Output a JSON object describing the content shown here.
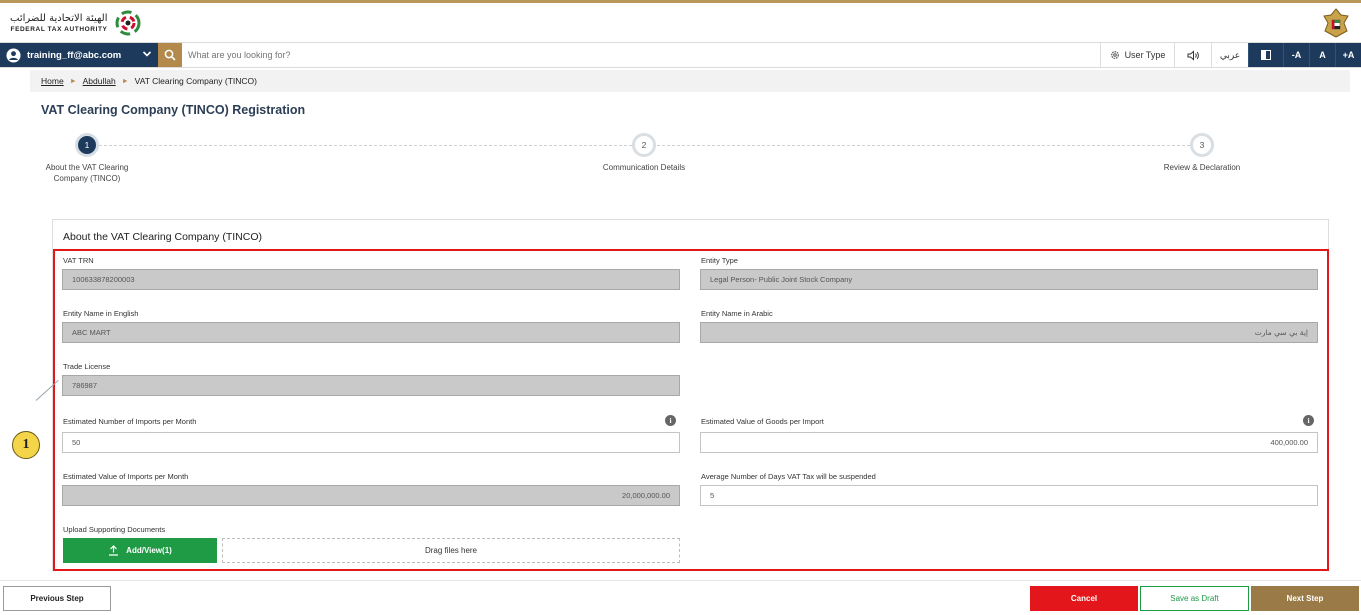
{
  "header": {
    "org_name_ar": "الهيئة الاتحادية للضرائب",
    "org_name_en": "FEDERAL TAX AUTHORITY"
  },
  "nav": {
    "user_email": "training_ff@abc.com",
    "search_placeholder": "What are you looking for?",
    "user_type": "User Type",
    "language": "عربي",
    "font_decrease": "-A",
    "font_normal": "A",
    "font_increase": "+A"
  },
  "breadcrumb": {
    "items": [
      "Home",
      "Abdullah"
    ],
    "current": "VAT Clearing Company (TINCO)"
  },
  "page": {
    "title": "VAT Clearing Company (TINCO) Registration"
  },
  "stepper": {
    "steps": [
      {
        "number": "1",
        "label": "About the VAT Clearing Company (TINCO)"
      },
      {
        "number": "2",
        "label": "Communication Details"
      },
      {
        "number": "3",
        "label": "Review & Declaration"
      }
    ]
  },
  "form": {
    "section_title": "About the VAT Clearing Company (TINCO)",
    "vat_trn": {
      "label": "VAT TRN",
      "value": "100633878200003"
    },
    "entity_type": {
      "label": "Entity Type",
      "value": "Legal Person- Public Joint Stock Company"
    },
    "entity_name_en": {
      "label": "Entity Name in English",
      "value": "ABC MART"
    },
    "entity_name_ar": {
      "label": "Entity Name in Arabic",
      "value": "إية بي سي مارت"
    },
    "trade_license": {
      "label": "Trade License",
      "value": "786987"
    },
    "imports_per_month": {
      "label": "Estimated Number of Imports per Month",
      "value": "50"
    },
    "value_per_import": {
      "label": "Estimated Value of Goods per Import",
      "value": "400,000.00"
    },
    "value_imports_month": {
      "label": "Estimated Value of Imports per Month",
      "value": "20,000,000.00"
    },
    "days_suspended": {
      "label": "Average Number of Days VAT Tax will be suspended",
      "value": "5"
    },
    "upload": {
      "label": "Upload Supporting Documents",
      "button": "Add/View(1)",
      "dropzone": "Drag files here"
    }
  },
  "annotation": {
    "callout_number": "1"
  },
  "footer": {
    "previous": "Previous Step",
    "cancel": "Cancel",
    "save_draft": "Save as Draft",
    "next": "Next Step"
  },
  "colors": {
    "navy": "#1d3a5c",
    "gold": "#b38a4b",
    "green": "#1f9a45",
    "red": "#e3161b",
    "next_brown": "#9a7b47"
  }
}
